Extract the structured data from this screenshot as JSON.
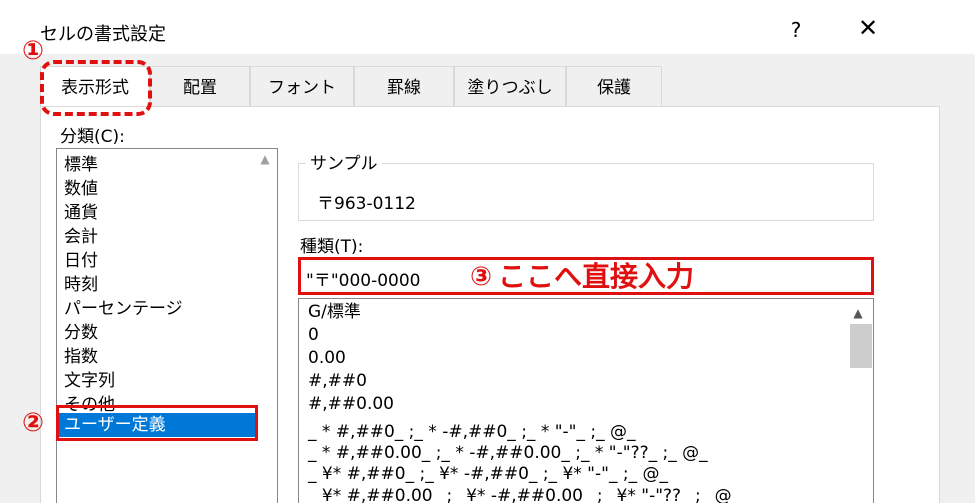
{
  "window": {
    "title": "セルの書式設定",
    "help_label": "?",
    "close_label": "✕"
  },
  "tabs": [
    {
      "label": "表示形式",
      "active": true
    },
    {
      "label": "配置"
    },
    {
      "label": "フォント"
    },
    {
      "label": "罫線"
    },
    {
      "label": "塗りつぶし"
    },
    {
      "label": "保護"
    }
  ],
  "category": {
    "label": "分類(C):",
    "items": [
      "標準",
      "数値",
      "通貨",
      "会計",
      "日付",
      "時刻",
      "パーセンテージ",
      "分数",
      "指数",
      "文字列",
      "その他",
      "ユーザー定義"
    ],
    "selected": "ユーザー定義"
  },
  "sample": {
    "legend": "サンプル",
    "value": "〒963-0112"
  },
  "type": {
    "label": "種類(T):",
    "value": "\"〒\"000-0000",
    "formats": [
      "G/標準",
      "0",
      "0.00",
      "#,##0",
      "#,##0.00",
      "_ * #,##0_ ;_ * -#,##0_ ;_ * \"-\"_ ;_ @_",
      "_ * #,##0.00_ ;_ * -#,##0.00_ ;_ * \"-\"??_ ;_ @_",
      "_ ¥* #,##0_ ;_ ¥* -#,##0_ ;_ ¥* \"-\"_ ;_ @_",
      "_ ¥* #,##0.00_ ;_ ¥* -#,##0.00_ ;_ ¥* \"-\"??_ ;_ @_"
    ]
  },
  "annotations": {
    "step1": "①",
    "step2": "②",
    "step3": "③",
    "step3_text": "ここへ直接入力",
    "color": "#e01010"
  }
}
